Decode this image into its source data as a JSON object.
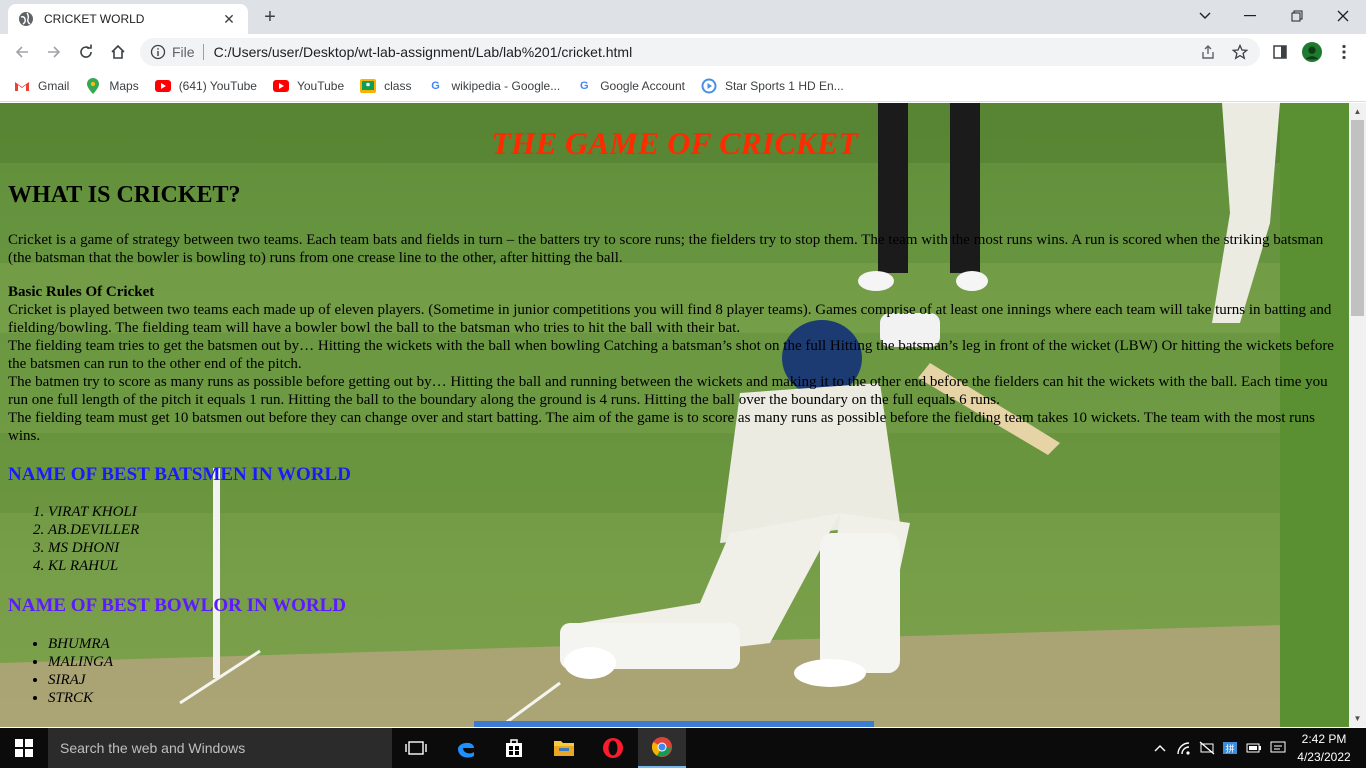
{
  "browser": {
    "tab_title": "CRICKET WORLD",
    "omnibox": {
      "scheme_label": "File",
      "url": "C:/Users/user/Desktop/wt-lab-assignment/Lab/lab%201/cricket.html"
    },
    "bookmarks": [
      {
        "label": "Gmail",
        "icon": "gmail-icon"
      },
      {
        "label": "Maps",
        "icon": "maps-icon"
      },
      {
        "label": "(641) YouTube",
        "icon": "youtube-icon"
      },
      {
        "label": "YouTube",
        "icon": "youtube-icon"
      },
      {
        "label": "class",
        "icon": "classroom-icon"
      },
      {
        "label": "wikipedia - Google...",
        "icon": "google-icon"
      },
      {
        "label": "Google Account",
        "icon": "google-icon"
      },
      {
        "label": "Star Sports 1 HD En...",
        "icon": "play-icon"
      }
    ]
  },
  "page": {
    "title": "THE GAME OF CRICKET",
    "heading": "WHAT IS CRICKET?",
    "intro": "Cricket is a game of strategy between two teams. Each team bats and fields in turn – the batters try to score runs; the fielders try to stop them. The team with the most runs wins. A run is scored when the striking batsman (the batsman that the bowler is bowling to) runs from one crease line to the other, after hitting the ball.",
    "rules_title": "Basic Rules Of Cricket",
    "rules": [
      "Cricket is played between two teams each made up of eleven players. (Sometime in junior competitions you will find 8 player teams). Games comprise of at least one innings where each team will take turns in batting and fielding/bowling. The fielding team will have a bowler bowl the ball to the batsman who tries to hit the ball with their bat.",
      "The fielding team tries to get the batsmen out by… Hitting the wickets with the ball when bowling Catching a batsman’s shot on the full Hitting the batsman’s leg in front of the wicket (LBW) Or hitting the wickets before the batsmen can run to the other end of the pitch.",
      "The batmen try to score as many runs as possible before getting out by… Hitting the ball and running between the wickets and making it to the other end before the fielders can hit the wickets with the ball. Each time you run one full length of the pitch it equals 1 run. Hitting the ball to the boundary along the ground is 4 runs. Hitting the ball over the boundary on the full equals 6 runs.",
      "The fielding team must get 10 batsmen out before they can change over and start batting. The aim of the game is to score as many runs as possible before the fielding team takes 10 wickets. The team with the most runs wins."
    ],
    "batsmen_heading": "NAME OF BEST BATSMEN IN WORLD",
    "batsmen": [
      "VIRAT KHOLI",
      "AB.DEVILLER",
      "MS DHONI",
      "KL RAHUL"
    ],
    "bowlers_heading": "NAME OF BEST BOWLOR IN WORLD",
    "bowlers": [
      "BHUMRA",
      "MALINGA",
      "SIRAJ",
      "STRCK"
    ],
    "colors": {
      "title": "#ff2a00",
      "batsmen_heading": "#1a1aff",
      "bowlers_heading": "#5b1aff"
    }
  },
  "taskbar": {
    "search_placeholder": "Search the web and Windows",
    "time": "2:42 PM",
    "date": "4/23/2022"
  }
}
